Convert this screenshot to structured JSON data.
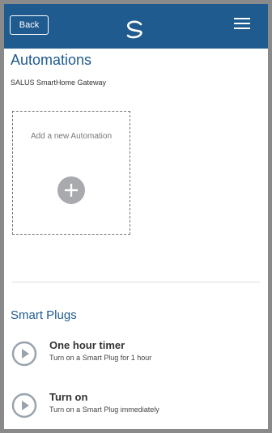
{
  "header": {
    "back_label": "Back",
    "logo_icon": "salus-logo-icon",
    "menu_icon": "hamburger-menu-icon",
    "bar_color": "#1f5b8f"
  },
  "main": {
    "title": "Automations",
    "gateway_name": "SALUS SmartHome Gateway",
    "add_card": {
      "label": "Add a new Automation",
      "icon": "plus-icon"
    }
  },
  "smart_plugs": {
    "title": "Smart Plugs",
    "items": [
      {
        "title": "One hour timer",
        "description": "Turn on a Smart Plug for 1 hour",
        "icon": "play-circle-icon"
      },
      {
        "title": "Turn on",
        "description": "Turn on a Smart Plug immediately",
        "icon": "play-circle-icon"
      }
    ]
  }
}
